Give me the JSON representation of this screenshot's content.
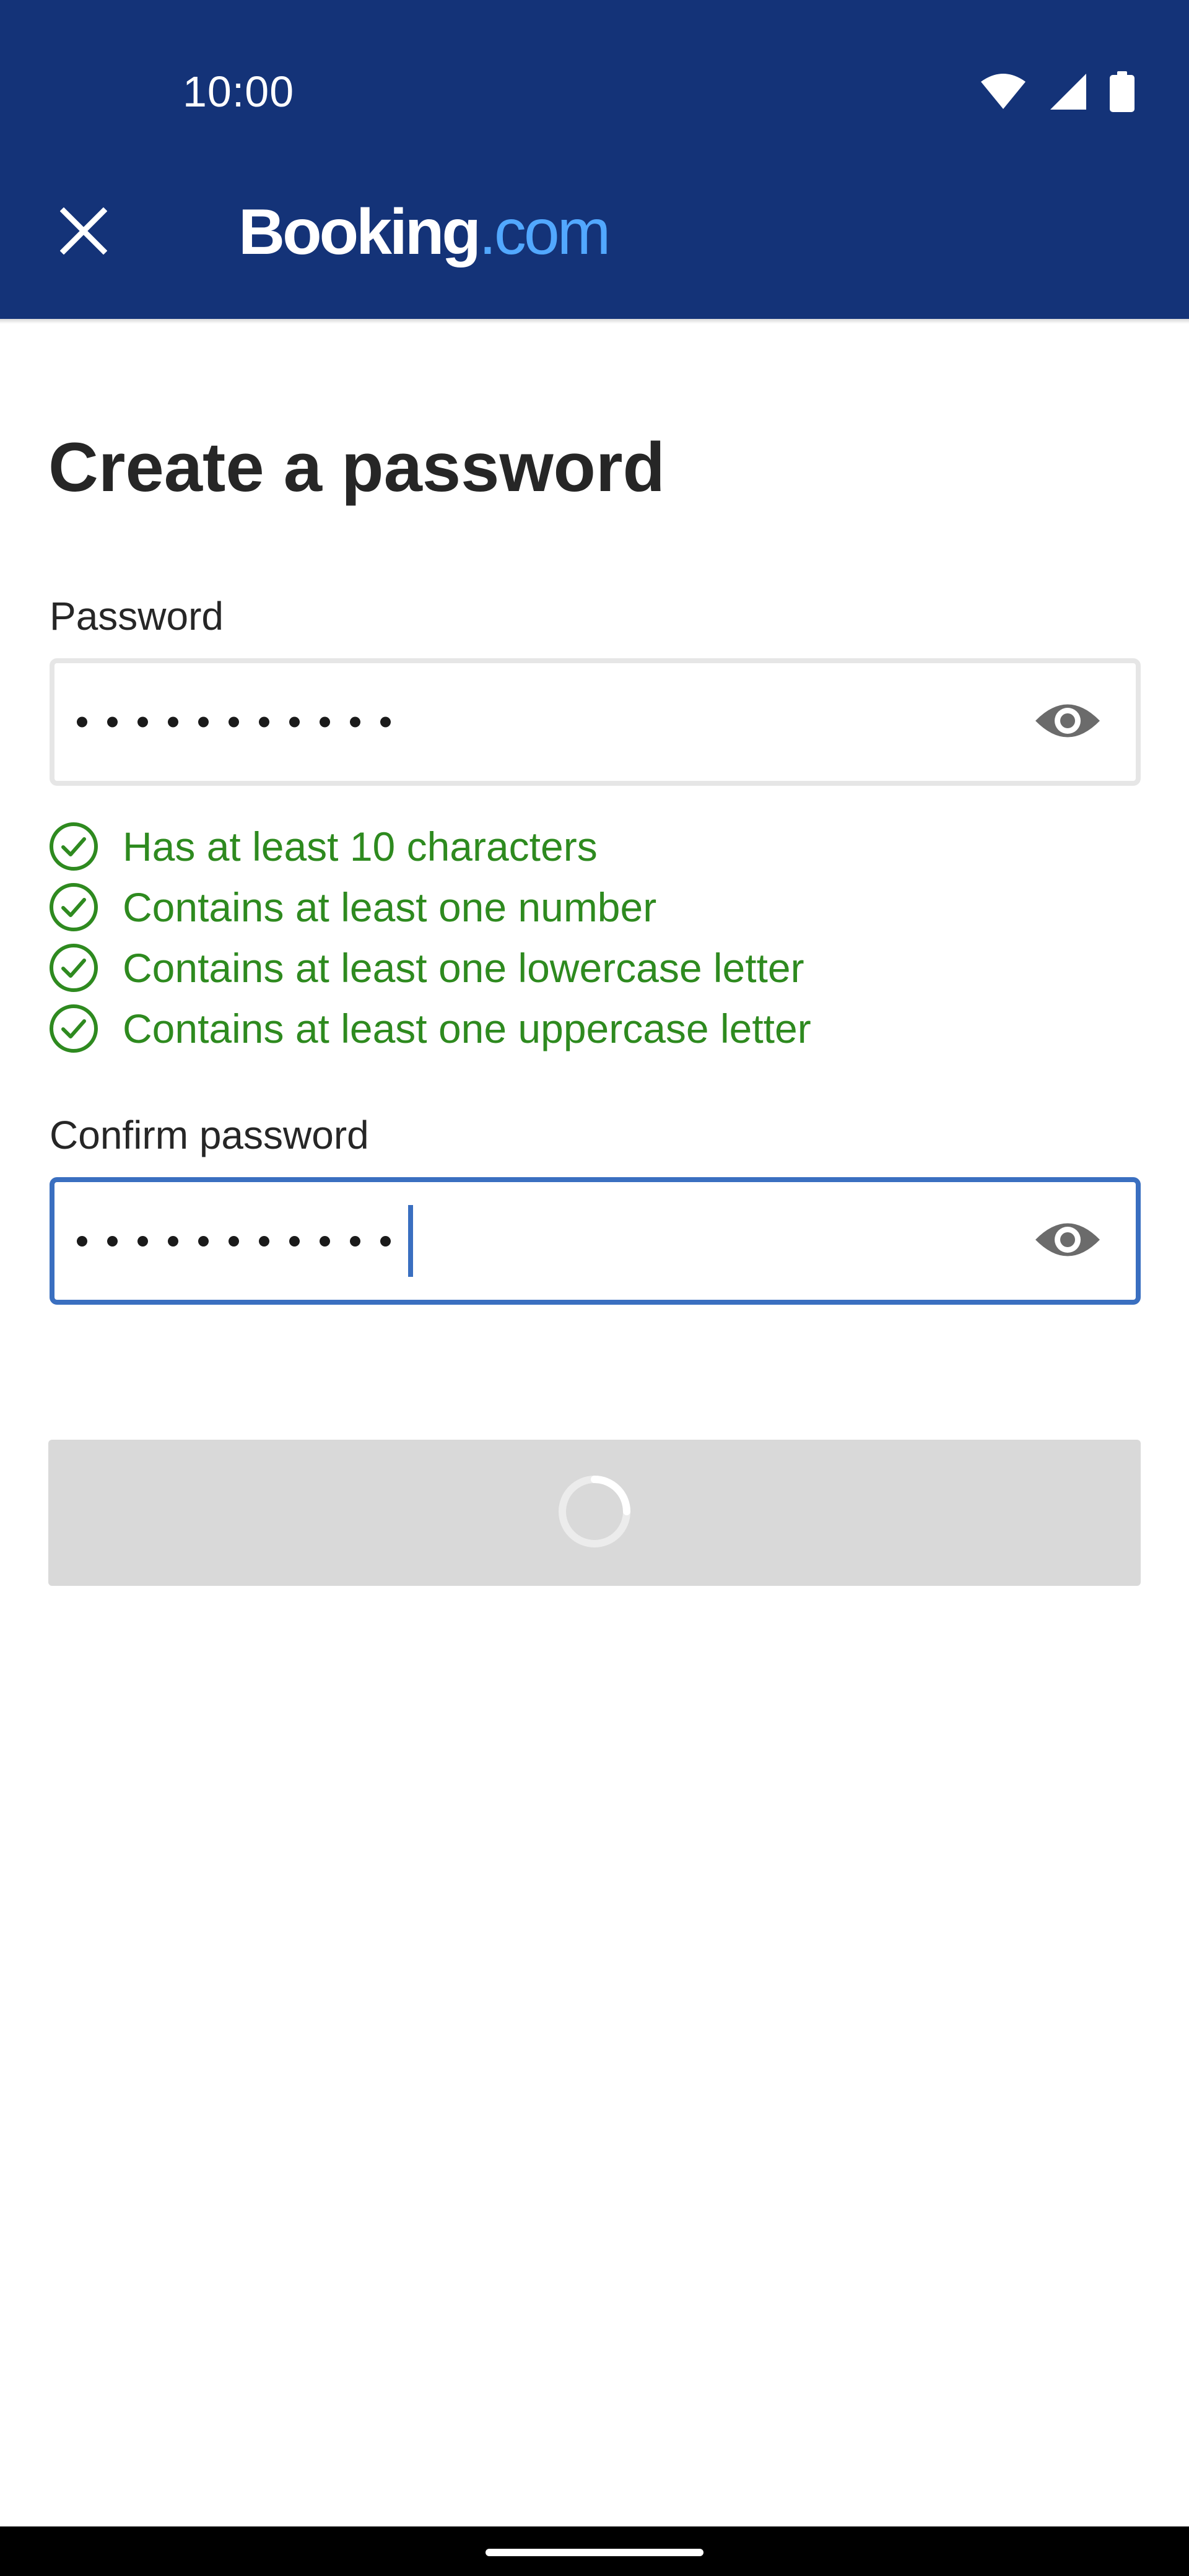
{
  "status_bar": {
    "time": "10:00",
    "icons": [
      "wifi-icon",
      "cell-signal-icon",
      "battery-icon"
    ]
  },
  "header": {
    "close_icon": "close-icon",
    "logo_main": "Booking",
    "logo_dot": ".",
    "logo_suffix": "com",
    "colors": {
      "background": "#143378",
      "logo_accent": "#52a8ff"
    }
  },
  "main": {
    "title": "Create a password",
    "password": {
      "label": "Password",
      "masked_length": 11,
      "visibility_icon": "eye-icon"
    },
    "requirements": [
      {
        "text": "Has at least 10 characters",
        "icon": "check-circle-icon",
        "met": true
      },
      {
        "text": "Contains at least one number",
        "icon": "check-circle-icon",
        "met": true
      },
      {
        "text": "Contains at least one lowercase letter",
        "icon": "check-circle-icon",
        "met": true
      },
      {
        "text": "Contains at least one uppercase letter",
        "icon": "check-circle-icon",
        "met": true
      }
    ],
    "confirm_password": {
      "label": "Confirm password",
      "masked_length": 11,
      "focused": true,
      "visibility_icon": "eye-icon"
    },
    "submit_button": {
      "state": "loading",
      "icon": "loading-spinner-icon"
    },
    "colors": {
      "success": "#2e8a1f",
      "focus_border": "#3a6fc0",
      "button_disabled": "#d9d9d9"
    }
  }
}
